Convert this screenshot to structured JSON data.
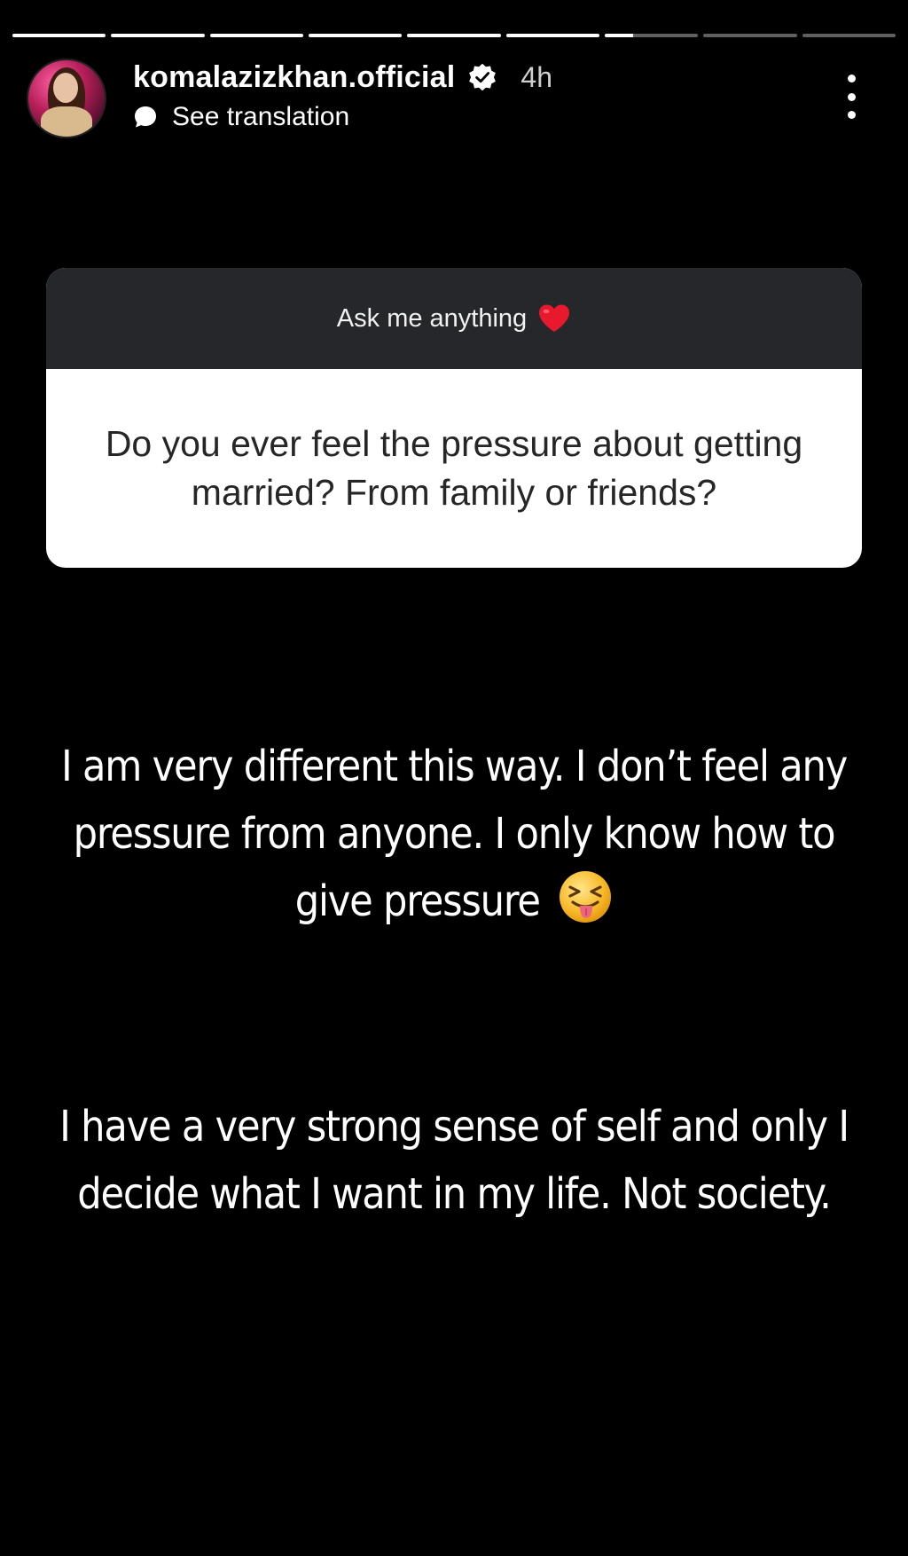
{
  "story": {
    "segments_total": 9,
    "segments_completed": 6,
    "current_segment_progress": 0.3
  },
  "header": {
    "username": "komalazizkhan.official",
    "verified": true,
    "time_ago": "4h",
    "translation_label": "See translation"
  },
  "question_sticker": {
    "title": "Ask me anything",
    "title_emoji": "red-heart",
    "question": "Do you ever feel the pressure about getting married? From family or friends?"
  },
  "answer": {
    "paragraph_1": "I am very different this way. I don’t feel any pressure from anyone. I only know how to give pressure",
    "paragraph_1_emoji": "squinting-face-with-tongue",
    "paragraph_2": "I have a very strong sense of self and only I decide what I want in my life. Not society."
  },
  "colors": {
    "background": "#000000",
    "sticker_header": "#26272b",
    "sticker_body": "#ffffff",
    "question_text": "#262626",
    "heart": "#e8192c"
  },
  "icons": {
    "verified": "verified-badge-icon",
    "translate": "chat-bubble-icon",
    "more": "more-options-icon"
  }
}
